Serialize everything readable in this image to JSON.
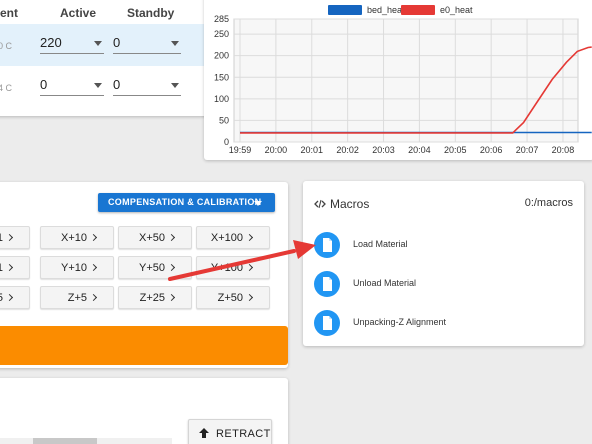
{
  "tools": {
    "headers": [
      "ent",
      "Active",
      "Standby"
    ],
    "rows": [
      {
        "label": "0 C",
        "active": "220",
        "standby": "0"
      },
      {
        "label": "4 C",
        "active": "0",
        "standby": "0"
      }
    ]
  },
  "chart_data": {
    "type": "line",
    "x": [
      "19:59",
      "20:00",
      "20:01",
      "20:02",
      "20:03",
      "20:04",
      "20:05",
      "20:06",
      "20:07",
      "20:08"
    ],
    "ylim": [
      0,
      285
    ],
    "yticks": [
      "285",
      "250",
      "200",
      "150",
      "100",
      "50",
      "0"
    ],
    "grid": true,
    "legend_position": "top",
    "series": [
      {
        "name": "bed_heat",
        "color": "#1565c0",
        "points": [
          [
            0,
            22
          ],
          [
            7.6,
            22
          ],
          [
            9.8,
            22
          ]
        ]
      },
      {
        "name": "e0_heat",
        "color": "#e53935",
        "points": [
          [
            0,
            21
          ],
          [
            7.6,
            21
          ],
          [
            7.9,
            45
          ],
          [
            8.3,
            95
          ],
          [
            8.7,
            145
          ],
          [
            9.1,
            185
          ],
          [
            9.4,
            210
          ],
          [
            9.7,
            219
          ],
          [
            9.8,
            220
          ]
        ]
      }
    ]
  },
  "movement": {
    "comp_label": "COMPENSATION & CALIBRATION",
    "rows": [
      [
        "1",
        "X+10",
        "X+50",
        "X+100"
      ],
      [
        "1",
        "Y+10",
        "Y+50",
        "Y+100"
      ],
      [
        "5",
        "Z+5",
        "Z+25",
        "Z+50"
      ]
    ]
  },
  "extruder": {
    "retract_label": "RETRACT"
  },
  "macros": {
    "title": "Macros",
    "path": "0:/macros",
    "items": [
      "Load Material",
      "Unload Material",
      "Unpacking-Z Alignment"
    ]
  },
  "annotation": {
    "arrow_color": "#e53935"
  }
}
